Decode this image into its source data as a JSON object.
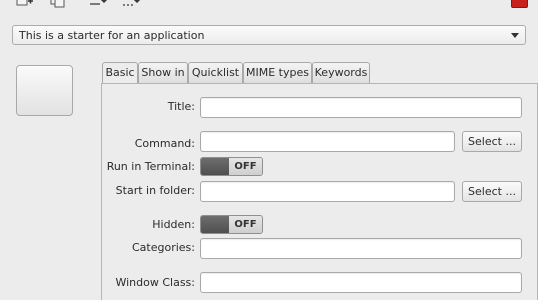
{
  "toolbar": {
    "icons": [
      "add-icon",
      "copy-icon",
      "download-icon",
      "download-more-icon"
    ],
    "close_color": "#c8201b"
  },
  "template": {
    "selected": "This is a starter for an application"
  },
  "tabs": [
    {
      "label": "Basic",
      "active": true
    },
    {
      "label": "Show in",
      "active": false
    },
    {
      "label": "Quicklist",
      "active": false
    },
    {
      "label": "MIME types",
      "active": false
    },
    {
      "label": "Keywords",
      "active": false
    }
  ],
  "form": {
    "title_label": "Title:",
    "title_value": "",
    "command_label": "Command:",
    "command_value": "",
    "command_select": "Select ...",
    "terminal_label": "Run in Terminal:",
    "terminal_state": "OFF",
    "folder_label": "Start in folder:",
    "folder_value": "",
    "folder_select": "Select ...",
    "hidden_label": "Hidden:",
    "hidden_state": "OFF",
    "categories_label": "Categories:",
    "categories_value": "",
    "wmclass_label": "Window Class:",
    "wmclass_value": ""
  }
}
